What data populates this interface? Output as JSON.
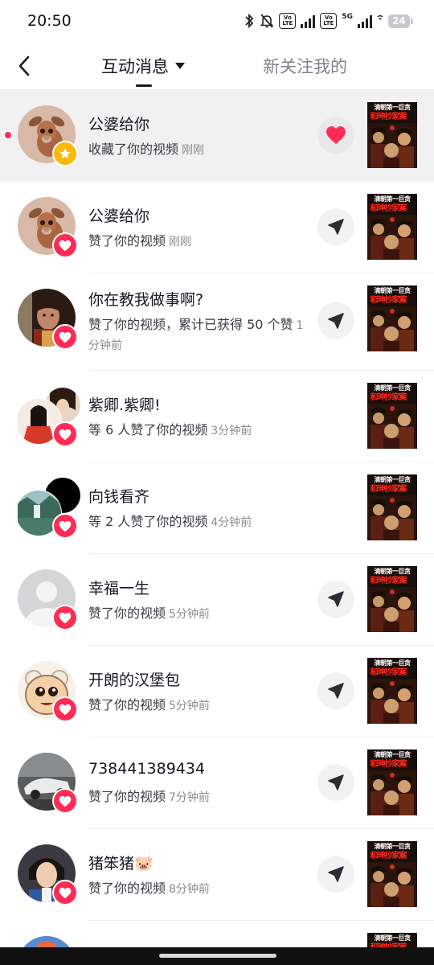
{
  "status_bar": {
    "time": "20:50",
    "volte1": "Vo LTE",
    "volte2": "Vo LTE",
    "net": "5G",
    "battery": "24",
    "icons": [
      "bluetooth-icon",
      "mute-bell-icon",
      "signal-icon",
      "wifi-icon",
      "battery-icon"
    ]
  },
  "header": {
    "back_icon": "back-arrow-icon",
    "tab_active": "互动消息",
    "tab_inactive": "新关注我的"
  },
  "thumbnail": {
    "line1": "清朝第一巨贪",
    "line2": "和珅抄家案"
  },
  "colors": {
    "accent": "#fe2c55",
    "favorite": "#f8b90b",
    "highlight_bg": "#f1f1f2"
  },
  "notifications": [
    {
      "name": "公婆给你",
      "text": "收藏了你的视频",
      "time": "刚刚",
      "badge": "favorite-star-icon",
      "action": "heart-icon",
      "unread": true
    },
    {
      "name": "公婆给你",
      "text": "赞了你的视频",
      "time": "刚刚",
      "badge": "like-heart-icon",
      "action": "send-icon"
    },
    {
      "name": "你在教我做事啊?",
      "text": "赞了你的视频，累计已获得 50 个赞",
      "time": "1分钟前",
      "badge": "like-heart-icon",
      "action": "send-icon"
    },
    {
      "name": "紫卿.紫卿!",
      "text": "等 6 人赞了你的视频",
      "time": "3分钟前",
      "badge": "like-heart-icon",
      "action": "none"
    },
    {
      "name": "向钱看齐",
      "text": "等 2 人赞了你的视频",
      "time": "4分钟前",
      "badge": "like-heart-icon",
      "action": "none"
    },
    {
      "name": "幸福一生",
      "text": "赞了你的视频",
      "time": "5分钟前",
      "badge": "like-heart-icon",
      "action": "send-icon"
    },
    {
      "name": "开朗的汉堡包",
      "text": "赞了你的视频",
      "time": "5分钟前",
      "badge": "like-heart-icon",
      "action": "send-icon"
    },
    {
      "name": "738441389434",
      "text": "赞了你的视频",
      "time": "7分钟前",
      "badge": "like-heart-icon",
      "action": "send-icon"
    },
    {
      "name": "猪笨猪🐷",
      "text": "赞了你的视频",
      "time": "8分钟前",
      "badge": "like-heart-icon",
      "action": "send-icon"
    }
  ]
}
